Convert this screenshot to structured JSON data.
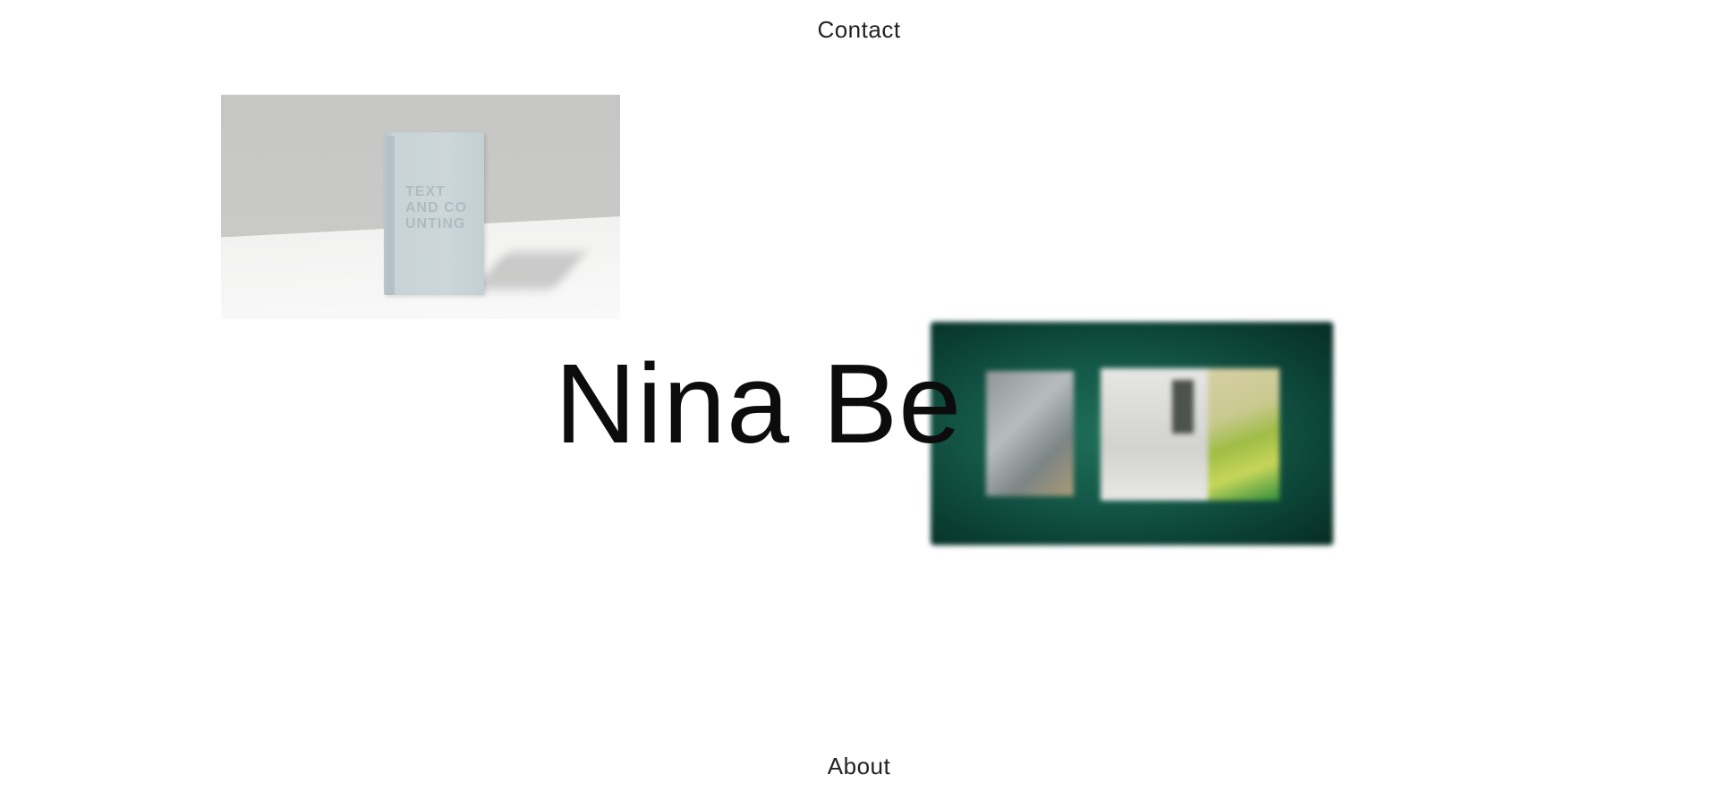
{
  "nav": {
    "contact_label": "Contact",
    "about_label": "About"
  },
  "hero": {
    "title": "Nina Be"
  },
  "projects": [
    {
      "cover_text": "TEXT AND CO UNTING"
    }
  ],
  "colors": {
    "background": "#ffffff",
    "text": "#0c0c0c",
    "accent_green": "#135747"
  }
}
